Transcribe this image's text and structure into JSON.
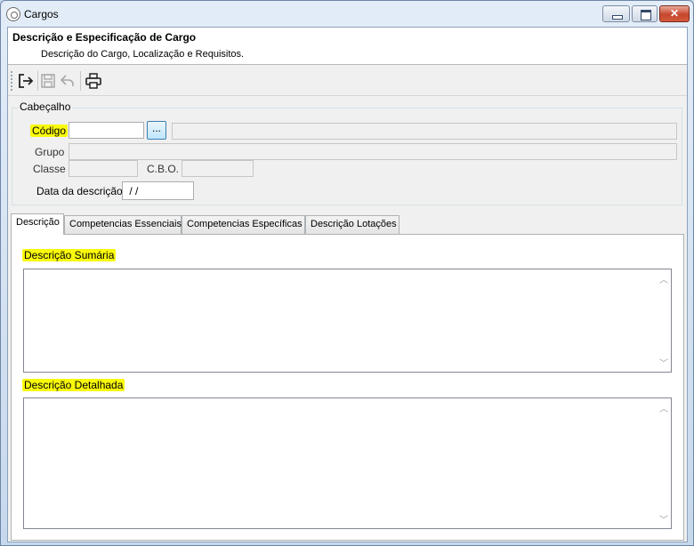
{
  "window": {
    "title": "Cargos"
  },
  "header": {
    "title": "Descrição e Especificação de Cargo",
    "subtitle": "Descrição do Cargo, Localização e Requisitos."
  },
  "toolbar": {
    "buttons": [
      {
        "icon": "exit-icon",
        "enabled": true
      },
      {
        "icon": "save-icon",
        "enabled": false
      },
      {
        "icon": "undo-icon",
        "enabled": false
      },
      {
        "icon": "print-icon",
        "enabled": true
      }
    ]
  },
  "cabecalho": {
    "legend": "Cabeçalho",
    "codigo": {
      "label": "Código",
      "value": "",
      "lookup_label": "...",
      "description": ""
    },
    "grupo": {
      "label": "Grupo",
      "value": ""
    },
    "classe": {
      "label": "Classe",
      "value": ""
    },
    "cbo": {
      "label": "C.B.O.",
      "value": ""
    },
    "data_descricao": {
      "label": "Data da descrição",
      "value": " / /"
    }
  },
  "tabs": [
    {
      "label": "Descrição",
      "active": true
    },
    {
      "label": "Competencias Essenciais",
      "active": false
    },
    {
      "label": "Competencias Específicas",
      "active": false
    },
    {
      "label": "Descrição Lotações",
      "active": false
    }
  ],
  "descricao_tab": {
    "sumaria_label": "Descrição Sumária",
    "sumaria_value": "",
    "detalhada_label": "Descrição Detalhada",
    "detalhada_value": ""
  },
  "colors": {
    "highlight": "#f9f90c",
    "title_bar": "#c6d8ec",
    "close_button": "#c7462c"
  }
}
